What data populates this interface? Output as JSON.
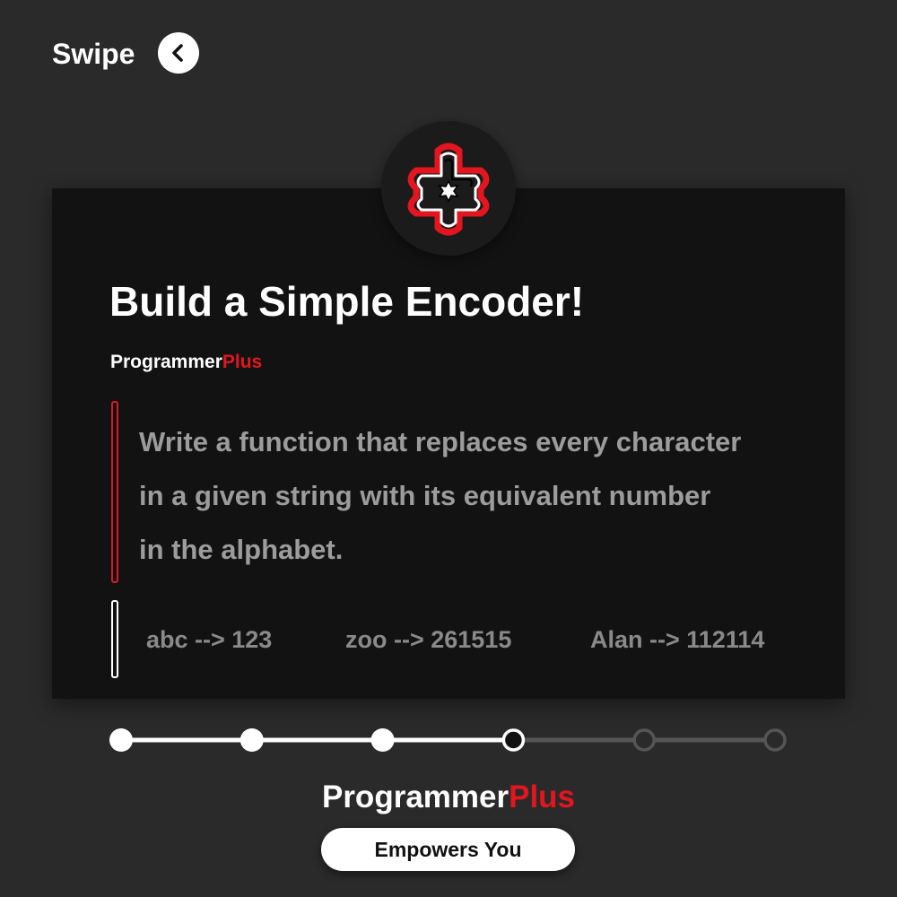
{
  "header": {
    "swipe_label": "Swipe",
    "swipe_icon": "chevron-left-icon"
  },
  "card": {
    "logo_icon": "programmerplus-logo-icon",
    "title": "Build a Simple Encoder!",
    "brand_name": "Programmer",
    "brand_accent": "Plus",
    "description_lines": [
      "Write a function that replaces every character",
      "in a given string with its equivalent number",
      "in the alphabet."
    ],
    "examples": [
      "abc --> 123",
      "zoo --> 261515",
      "Alan --> 112114"
    ]
  },
  "progress": {
    "total_steps": 6,
    "current_step": 4
  },
  "footer": {
    "brand_name": "Programmer",
    "brand_accent": "Plus",
    "tagline": "Empowers You"
  },
  "colors": {
    "background": "#2a2a2a",
    "card": "#121212",
    "accent_red": "#e3161f",
    "text_white": "#ffffff",
    "text_gray": "#9c9c9c"
  }
}
